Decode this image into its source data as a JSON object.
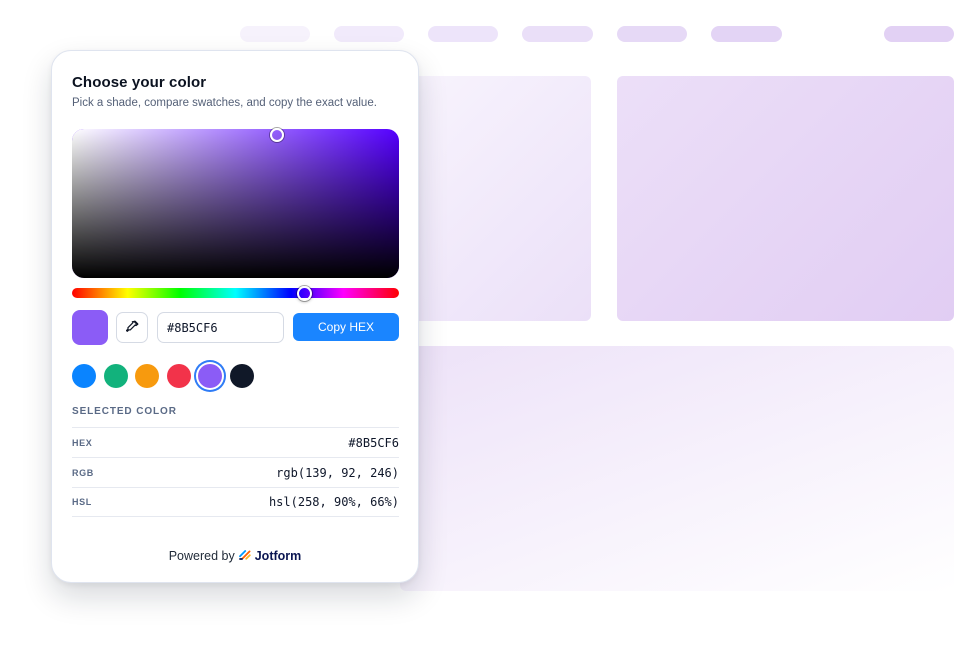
{
  "widget": {
    "title": "Choose your color",
    "subtitle": "Pick a shade, compare swatches, and copy the exact value.",
    "picker": {
      "hue_color": "#5500ff",
      "selected_color": "#8B5CF6",
      "hue_position": 0.71
    },
    "eyedropper_icon": "eyedropper-icon",
    "hex_input_value": "#8B5CF6",
    "copy_button_label": "Copy HEX",
    "copy_button_color": "#1a85ff",
    "swatches": [
      {
        "color": "#0a84ff",
        "selected": false
      },
      {
        "color": "#12b27c",
        "selected": false
      },
      {
        "color": "#f79a0e",
        "selected": false
      },
      {
        "color": "#f2334a",
        "selected": false
      },
      {
        "color": "#8B5CF6",
        "selected": true
      },
      {
        "color": "#101828",
        "selected": false
      }
    ],
    "selected_heading": "SELECTED COLOR",
    "values": [
      {
        "label": "HEX",
        "value": "#8B5CF6"
      },
      {
        "label": "RGB",
        "value": "rgb(139, 92, 246)"
      },
      {
        "label": "HSL",
        "value": "hsl(258, 90%, 66%)"
      }
    ],
    "footer": {
      "prefix": "Powered by",
      "brand": "Jotform"
    }
  }
}
